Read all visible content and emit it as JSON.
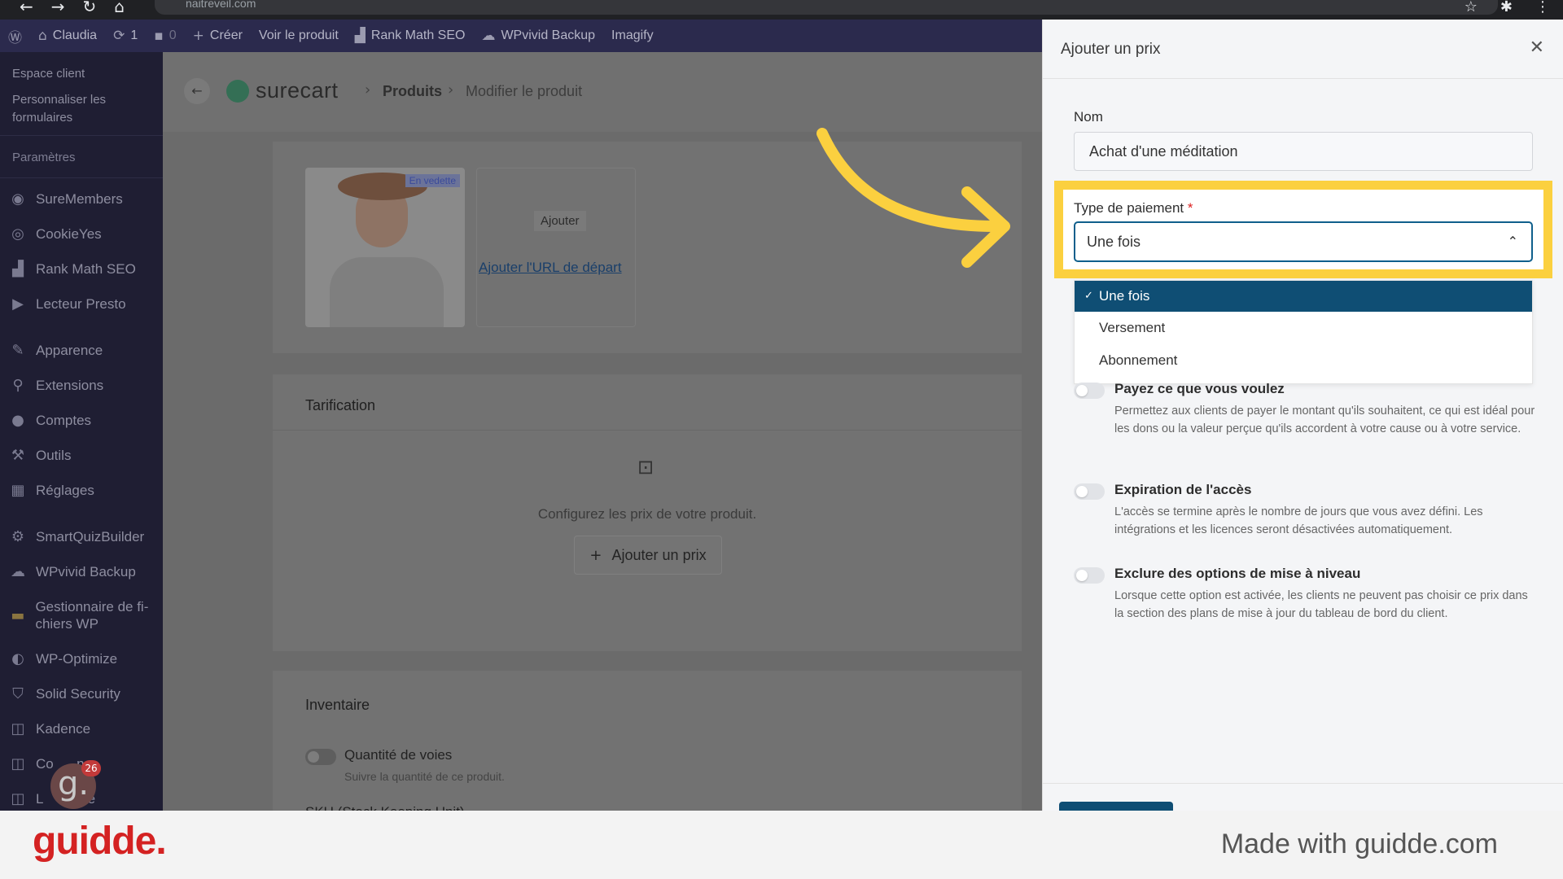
{
  "browser": {
    "url": "naitreveil.com"
  },
  "adminbar": {
    "user": "Claudia",
    "updates": "1",
    "comments": "0",
    "create": "Créer",
    "view_product": "Voir le produit",
    "rank_math": "Rank Math SEO",
    "wpvivid": "WPvivid Backup",
    "imagify": "Imagify"
  },
  "sidebar": {
    "top_links": [
      "Espace client",
      "Personnaliser les formulaires"
    ],
    "section": "Paramètres",
    "items": [
      {
        "label": "SureMembers",
        "icon": "suremembers-icon"
      },
      {
        "label": "CookieYes",
        "icon": "cookie-icon"
      },
      {
        "label": "Rank Math SEO",
        "icon": "chart-icon"
      },
      {
        "label": "Lecteur Presto",
        "icon": "play-icon"
      },
      {
        "label": "Apparence",
        "icon": "brush-icon"
      },
      {
        "label": "Extensions",
        "icon": "plugin-icon"
      },
      {
        "label": "Comptes",
        "icon": "user-icon"
      },
      {
        "label": "Outils",
        "icon": "wrench-icon"
      },
      {
        "label": "Réglages",
        "icon": "settings-icon"
      },
      {
        "label": "SmartQuizBuilder",
        "icon": "gear-icon"
      },
      {
        "label": "WPvivid Backup",
        "icon": "cloud-icon"
      },
      {
        "label": "Gestionnaire de fi-chiers WP",
        "icon": "folder-icon"
      },
      {
        "label": "WP-Optimize",
        "icon": "optimize-icon"
      },
      {
        "label": "Solid Security",
        "icon": "shield-icon"
      },
      {
        "label": "Kadence",
        "icon": "kadence-icon"
      },
      {
        "label": "Co      ns",
        "icon": "conversions-icon"
      },
      {
        "label": "L      slate",
        "icon": "translate-icon"
      }
    ]
  },
  "main": {
    "brand": "surecart",
    "crumb_products": "Produits",
    "crumb_edit": "Modifier le produit",
    "media": {
      "featured_badge": "En vedette",
      "add_button": "Ajouter",
      "add_url_link": "Ajouter l'URL de départ"
    },
    "pricing": {
      "title": "Tarification",
      "empty_text": "Configurez les prix de votre produit.",
      "add_price_button": "Ajouter un prix"
    },
    "inventory": {
      "title": "Inventaire",
      "track_label": "Quantité de voies",
      "track_sub": "Suivre la quantité de ce produit.",
      "sku_label": "SKU (Stock Keeping Unit)"
    }
  },
  "drawer": {
    "title": "Ajouter un prix",
    "name_label": "Nom",
    "name_value": "Achat d'une méditation",
    "payment_type_label": "Type de paiement",
    "payment_type_required": "*",
    "payment_type_value": "Une fois",
    "options": [
      "Une fois",
      "Versement",
      "Abonnement"
    ],
    "selected_option": "Une fois",
    "toggles": [
      {
        "title": "Payez ce que vous voulez",
        "desc": "Permettez aux clients de payer le montant qu'ils souhaitent, ce qui est idéal pour les dons ou la valeur perçue qu'ils accordent à votre cause ou à votre service."
      },
      {
        "title": "Expiration de l'accès",
        "desc": "L'accès se termine après le nombre de jours que vous avez défini. Les intégrations et les licences seront désactivées automatiquement."
      },
      {
        "title": "Exclure des options de mise à niveau",
        "desc": "Lorsque cette option est activée, les clients ne peuvent pas choisir ce prix dans la section des plans de mise à jour du tableau de bord du client."
      }
    ]
  },
  "avatar": {
    "letter": "g.",
    "badge": "26"
  },
  "footer": {
    "brand": "guidde.",
    "made_with": "Made with guidde.com"
  },
  "colors": {
    "highlight": "#fbd03f",
    "selected_option": "#0f4e74",
    "brand_red": "#d42222"
  }
}
